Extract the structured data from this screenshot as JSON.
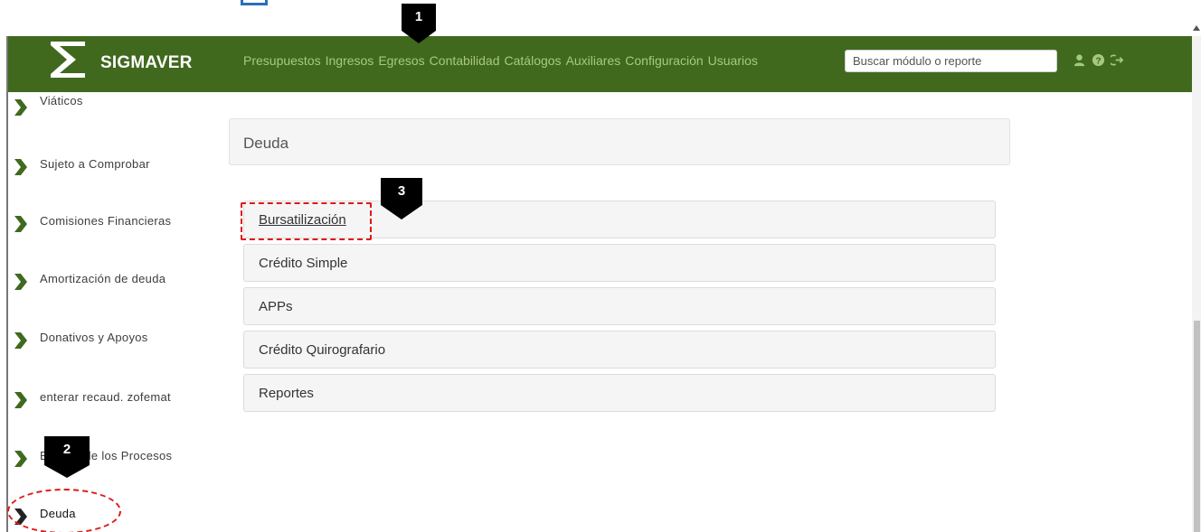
{
  "navbar": {
    "brand": "SIGMAVER",
    "menu": [
      "Presupuestos",
      "Ingresos",
      "Egresos",
      "Contabilidad",
      "Catálogos",
      "Auxiliares",
      "Configuración",
      "Usuarios"
    ],
    "search_placeholder": "Buscar módulo o reporte",
    "icons": [
      "user-icon",
      "help-icon",
      "logout-icon"
    ],
    "bg_color": "#40691e",
    "link_color": "#a7c97f"
  },
  "sidebar": {
    "items": [
      {
        "label": "Viáticos"
      },
      {
        "label": "Sujeto a Comprobar"
      },
      {
        "label": "Comisiones Financieras"
      },
      {
        "label": "Amortización de deuda"
      },
      {
        "label": "Donativos y Apoyos"
      },
      {
        "label": "enterar recaud. zofemat"
      },
      {
        "label": "Estatus de los Procesos"
      },
      {
        "label": "Deuda"
      }
    ],
    "chevron_color": "#3f6a1f"
  },
  "main": {
    "title": "Deuda",
    "items": [
      {
        "label": "Bursatilización"
      },
      {
        "label": "Crédito Simple"
      },
      {
        "label": "APPs"
      },
      {
        "label": "Crédito Quirografario"
      },
      {
        "label": "Reportes"
      }
    ]
  },
  "callouts": {
    "one": "1",
    "two": "2",
    "three": "3",
    "highlight_color": "#e01818"
  }
}
